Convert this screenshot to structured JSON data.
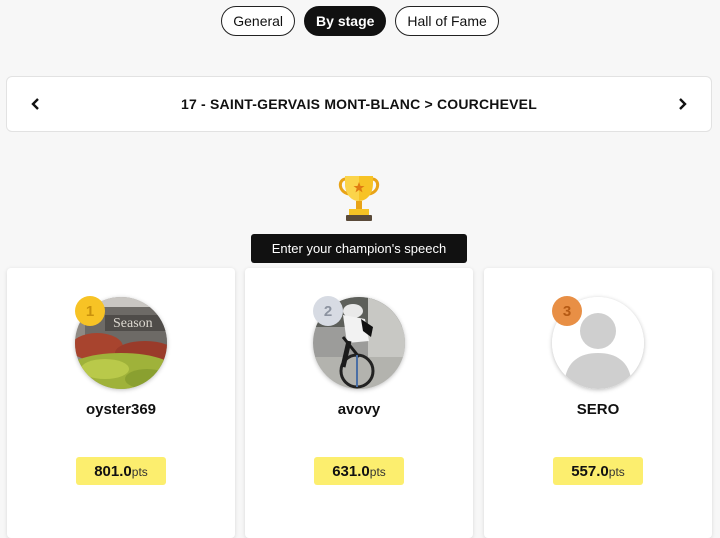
{
  "tabs": [
    {
      "label": "General",
      "active": false
    },
    {
      "label": "By stage",
      "active": true
    },
    {
      "label": "Hall of Fame",
      "active": false
    }
  ],
  "stage": {
    "title": "17 - SAINT-GERVAIS MONT-BLANC > COURCHEVEL",
    "prev_icon": "chevron-left-icon",
    "next_icon": "chevron-right-icon"
  },
  "trophy_icon": "trophy-icon",
  "speech_button": "Enter your champion's speech",
  "podium": [
    {
      "rank": "1",
      "username": "oyster369",
      "points": "801.0",
      "unit": "pts"
    },
    {
      "rank": "2",
      "username": "avovy",
      "points": "631.0",
      "unit": "pts"
    },
    {
      "rank": "3",
      "username": "SERO",
      "points": "557.0",
      "unit": "pts"
    }
  ],
  "colors": {
    "accent_dark": "#111111",
    "points_bg": "#fcee6e",
    "gold": "#f7c325",
    "silver": "#d7dbe3",
    "bronze": "#e88f45"
  }
}
